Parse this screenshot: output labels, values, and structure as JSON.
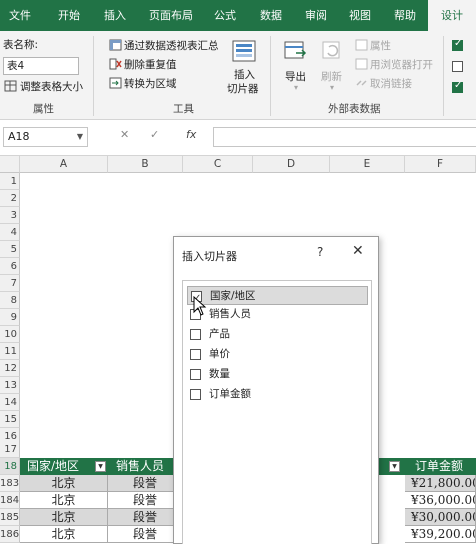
{
  "ribbon_tabs": [
    "文件",
    "开始",
    "插入",
    "页面布局",
    "公式",
    "数据",
    "审阅",
    "视图",
    "帮助",
    "设计"
  ],
  "properties": {
    "table_name_label": "表名称:",
    "table_name_value": "表4",
    "resize_label": "调整表格大小",
    "group_label": "属性"
  },
  "tools": {
    "pivot_label": "通过数据透视表汇总",
    "remove_dup_label": "删除重复值",
    "convert_label": "转换为区域",
    "slicer_label_1": "插入",
    "slicer_label_2": "切片器",
    "group_label": "工具"
  },
  "external": {
    "export_label": "导出",
    "refresh_label": "刷新",
    "properties_label": "属性",
    "browser_label": "用浏览器打开",
    "unlink_label": "取消链接",
    "group_label": "外部表数据"
  },
  "formula_bar": {
    "cell_ref": "A18",
    "cancel": "✕",
    "enter": "✓",
    "fx": "fx"
  },
  "columns": [
    "A",
    "B",
    "C",
    "D",
    "E",
    "F"
  ],
  "rows": [
    "1",
    "2",
    "3",
    "4",
    "5",
    "6",
    "7",
    "8",
    "9",
    "10",
    "11",
    "12",
    "13",
    "14",
    "15",
    "16",
    "17",
    "18",
    "183",
    "184",
    "185",
    "186"
  ],
  "table_header": {
    "col_a": "国家/地区",
    "col_b": "销售人员",
    "col_f": "订单金额"
  },
  "table_rows": [
    {
      "country": "北京",
      "sales": "段誉",
      "amount": "¥21,800.00"
    },
    {
      "country": "北京",
      "sales": "段誉",
      "amount": "¥36,000.00"
    },
    {
      "country": "北京",
      "sales": "段誉",
      "amount": "¥30,000.00"
    },
    {
      "country": "北京",
      "sales": "段誉",
      "amount": "¥39,200.00"
    }
  ],
  "dialog": {
    "title": "插入切片器",
    "help": "?",
    "close": "✕",
    "items": [
      {
        "label": "国家/地区",
        "checked": true
      },
      {
        "label": "销售人员",
        "checked": false
      },
      {
        "label": "产品",
        "checked": false
      },
      {
        "label": "单价",
        "checked": false
      },
      {
        "label": "数量",
        "checked": false
      },
      {
        "label": "订单金额",
        "checked": false
      }
    ]
  },
  "colors": {
    "brand": "#217346",
    "ribbon_bg": "#f3f3f3",
    "row_band": "#d9d9d9"
  }
}
